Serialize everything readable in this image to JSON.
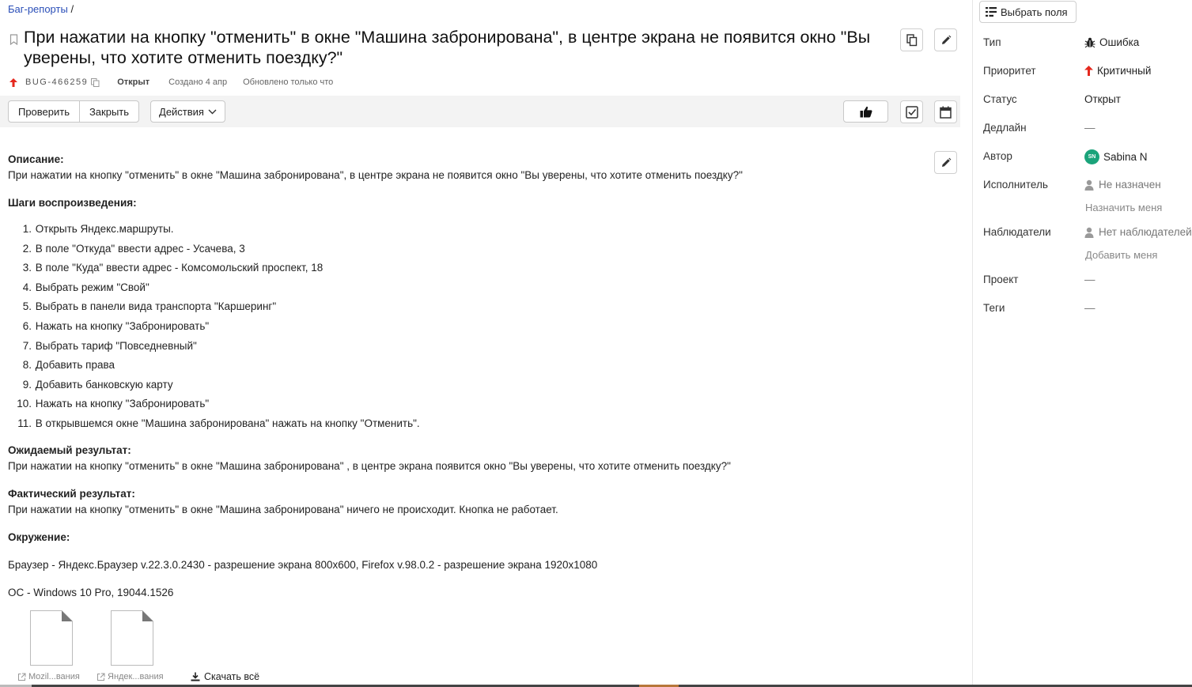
{
  "breadcrumb": {
    "link": "Баг-репорты",
    "sep": "/"
  },
  "issue": {
    "title": "При нажатии на кнопку \"отменить\" в окне \"Машина забронирована\", в центре экрана не появится окно \"Вы уверены, что хотите отменить поездку?\"",
    "key": "BUG-466259",
    "status": "Открыт",
    "created": "Создано 4 апр",
    "updated": "Обновлено только что"
  },
  "toolbar": {
    "check_label": "Проверить",
    "close_label": "Закрыть",
    "actions_label": "Действия"
  },
  "description": {
    "h_desc": "Описание:",
    "desc_text": "При нажатии на кнопку \"отменить\" в окне \"Машина забронирована\", в центре экрана не появится окно \"Вы уверены, что хотите отменить поездку?\"",
    "h_steps": "Шаги воспроизведения:",
    "steps": [
      "Открыть Яндекс.маршруты.",
      "В поле \"Откуда\" ввести адрес - Усачева, 3",
      "В поле \"Куда\" ввести адрес - Комсомольский проспект, 18",
      "Выбрать режим \"Свой\"",
      "Выбрать в панели вида транспорта \"Каршеринг\"",
      "Нажать на кнопку \"Забронировать\"",
      "Выбрать тариф \"Повседневный\"",
      "Добавить права",
      "Добавить банковскую карту",
      "Нажать на кнопку \"Забронировать\"",
      "В открывшемся окне \"Машина забронирована\" нажать на кнопку \"Отменить\"."
    ],
    "h_expected": "Ожидаемый результат:",
    "expected": "При нажатии на кнопку \"отменить\" в окне \"Машина забронирована\" , в центре экрана появится окно \"Вы уверены, что хотите отменить поездку?\"",
    "h_actual": "Фактический результат:",
    "actual": "При нажатии на кнопку \"отменить\" в окне \"Машина забронирована\" ничего не происходит. Кнопка не работает.",
    "h_env": "Окружение:",
    "env_browser": "Браузер - Яндекс.Браузер v.22.3.0.2430 - разрешение экрана 800x600, Firefox v.98.0.2 - разрешение экрана 1920x1080",
    "env_os": "ОС - Windows 10 Pro, 19044.1526"
  },
  "attachments": {
    "files": [
      "Mozil...вания",
      "Яндек...вания"
    ],
    "download_all": "Скачать всё"
  },
  "sidebar": {
    "choose_fields": "Выбрать поля",
    "type_label": "Тип",
    "type_value": "Ошибка",
    "priority_label": "Приоритет",
    "priority_value": "Критичный",
    "status_label": "Статус",
    "status_value": "Открыт",
    "deadline_label": "Дедлайн",
    "deadline_value": "—",
    "author_label": "Автор",
    "author_initials": "SN",
    "author_value": "Sabina N",
    "assignee_label": "Исполнитель",
    "assignee_value": "Не назначен",
    "assign_me": "Назначить меня",
    "watchers_label": "Наблюдатели",
    "watchers_value": "Нет наблюдателей",
    "add_me": "Добавить меня",
    "project_label": "Проект",
    "project_value": "—",
    "tags_label": "Теги",
    "tags_value": "—"
  },
  "colors": {
    "accent_red": "#e5281e",
    "avatar_green": "#1aa37a",
    "link_blue": "#2b4fb8"
  },
  "icons": {
    "bookmark": "bookmark-icon",
    "copy": "copy-icon",
    "edit": "pencil-icon",
    "like": "thumbs-up-icon",
    "checklist": "checkbox-icon",
    "calendar": "calendar-icon",
    "bug": "bug-icon",
    "person": "person-icon",
    "download": "download-icon",
    "external": "external-link-icon"
  }
}
